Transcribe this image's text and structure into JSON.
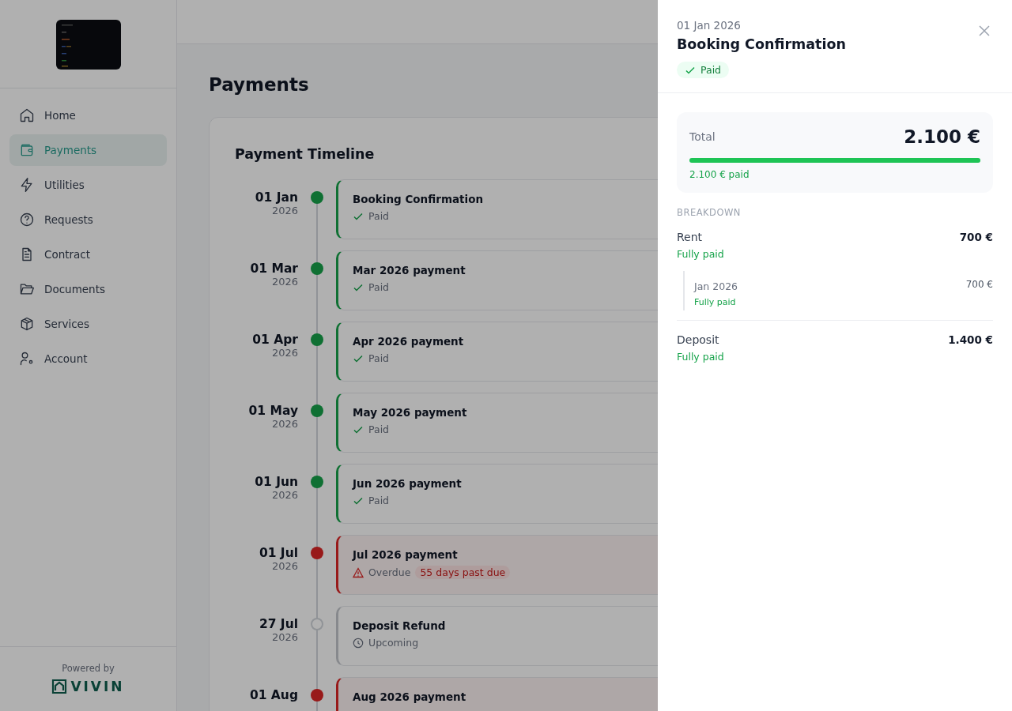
{
  "sidebar": {
    "items": [
      {
        "label": "Home",
        "selected": false
      },
      {
        "label": "Payments",
        "selected": true
      },
      {
        "label": "Utilities",
        "selected": false
      },
      {
        "label": "Requests",
        "selected": false
      },
      {
        "label": "Contract",
        "selected": false
      },
      {
        "label": "Documents",
        "selected": false
      },
      {
        "label": "Services",
        "selected": false
      },
      {
        "label": "Account",
        "selected": false
      }
    ],
    "footer": {
      "powered_by": "Powered by",
      "brand": "VIVIN"
    }
  },
  "page": {
    "title": "Payments",
    "timeline_title": "Payment Timeline",
    "events": [
      {
        "day": "01 Jan",
        "year": "2026",
        "title": "Booking Confirmation",
        "kind": "paid",
        "status": "Paid"
      },
      {
        "day": "01 Mar",
        "year": "2026",
        "title": "Mar 2026 payment",
        "kind": "paid",
        "status": "Paid"
      },
      {
        "day": "01 Apr",
        "year": "2026",
        "title": "Apr 2026 payment",
        "kind": "paid",
        "status": "Paid"
      },
      {
        "day": "01 May",
        "year": "2026",
        "title": "May 2026 payment",
        "kind": "paid",
        "status": "Paid"
      },
      {
        "day": "01 Jun",
        "year": "2026",
        "title": "Jun 2026 payment",
        "kind": "paid",
        "status": "Paid"
      },
      {
        "day": "01 Jul",
        "year": "2026",
        "title": "Jul 2026 payment",
        "kind": "overdue",
        "status": "Overdue",
        "badge": "55 days past due"
      },
      {
        "day": "27 Jul",
        "year": "2026",
        "title": "Deposit Refund",
        "kind": "upcoming",
        "status": "Upcoming"
      },
      {
        "day": "01 Aug",
        "title": "Aug 2026 payment",
        "kind": "overdue"
      }
    ]
  },
  "drawer": {
    "date": "01 Jan 2026",
    "title": "Booking Confirmation",
    "status": {
      "kind": "paid",
      "label": "Paid"
    },
    "total": {
      "label": "Total",
      "amount": "2.100 €",
      "level": 1,
      "paid": "2.100 € paid"
    },
    "breakdown_label": "BREAKDOWN",
    "items": [
      {
        "name": "Rent",
        "amount": "700 €",
        "status": "Fully paid",
        "children": [
          {
            "name": "Jan 2026",
            "amount": "700 €",
            "status": "Fully paid"
          }
        ]
      },
      {
        "name": "Deposit",
        "amount": "1.400 €",
        "status": "Fully paid"
      }
    ]
  }
}
